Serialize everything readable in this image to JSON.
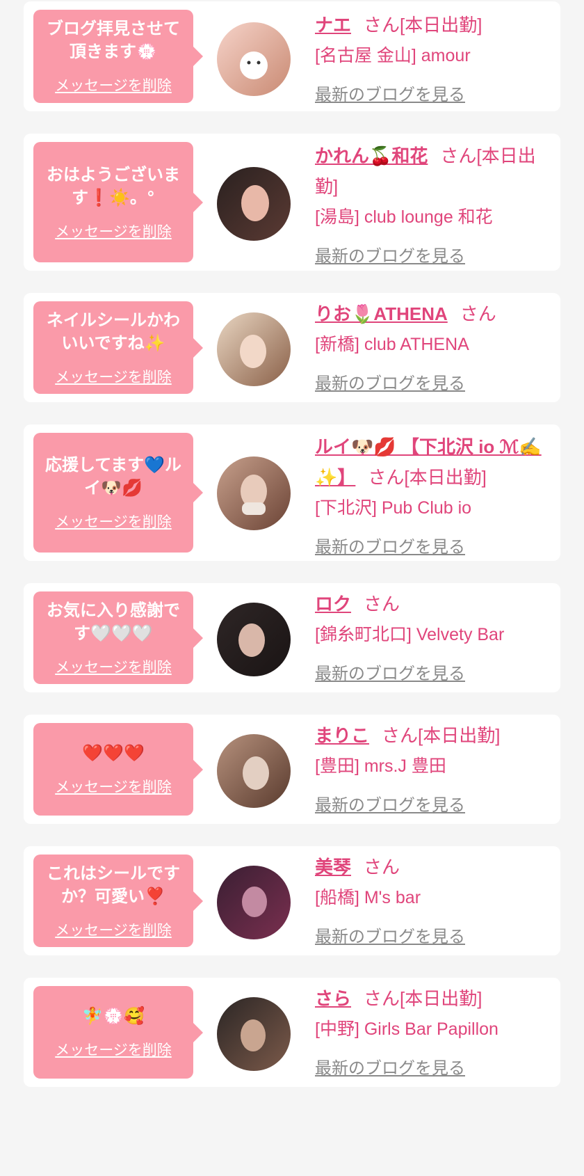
{
  "delete_label": "メッセージを削除",
  "blog_label": "最新のブログを見る",
  "colors": {
    "background": "#f5f5f5",
    "bubble": "#fa9aa9",
    "accent": "#e0457b",
    "blog_link": "#8a8a8a"
  },
  "entries": [
    {
      "message": "ブログ拝見させて頂きます💮",
      "name": "ナエ",
      "suffix": "さん[本日出勤]",
      "shop": "[名古屋 金山] amour",
      "avatar_colors": [
        "#f6d3c9",
        "#c98a73",
        "#ffffff"
      ]
    },
    {
      "message": "おはようございます❗☀️。°",
      "name": "かれん🍒和花",
      "suffix": "さん[本日出勤]",
      "shop": "[湯島] club lounge 和花",
      "avatar_colors": [
        "#2a2120",
        "#e8b8a8",
        "#5b3a33"
      ]
    },
    {
      "message": "ネイルシールかわいいですね✨",
      "name": "りお🌷ATHENA",
      "suffix": "さん",
      "shop": "[新橋] club ATHENA",
      "avatar_colors": [
        "#e9d6c2",
        "#c48f6e",
        "#8a6048"
      ]
    },
    {
      "message": "応援してます💙ルイ🐶💋",
      "name": "ルイ🐶💋 【下北沢 io ℳ✍ ✨】",
      "suffix": "さん[本日出勤]",
      "shop": "[下北沢] Pub Club io",
      "avatar_colors": [
        "#c7a08c",
        "#6b4335",
        "#efe6df"
      ]
    },
    {
      "message": "お気に入り感謝です🤍🤍🤍",
      "name": "ロク",
      "suffix": "さん",
      "shop": "[錦糸町北口] Velvety Bar",
      "avatar_colors": [
        "#2e2626",
        "#d9b7a9",
        "#1a1414"
      ]
    },
    {
      "message": "❤️❤️❤️",
      "name": "まりこ",
      "suffix": "さん[本日出勤]",
      "shop": "[豊田] mrs.J 豊田",
      "avatar_colors": [
        "#b6917d",
        "#5a3b2e",
        "#e3cfc2"
      ]
    },
    {
      "message": "これはシールですか？可愛い❣️",
      "name": "美琴",
      "suffix": "さん",
      "shop": "[船橋] M's bar",
      "avatar_colors": [
        "#3a1f33",
        "#7a2f4f",
        "#c38aa2"
      ]
    },
    {
      "message": "🧚💮🥰",
      "name": "さら",
      "suffix": "さん[本日出勤]",
      "shop": "[中野] Girls Bar Papillon",
      "avatar_colors": [
        "#2b2625",
        "#c9a590",
        "#7c5a4a"
      ]
    }
  ]
}
